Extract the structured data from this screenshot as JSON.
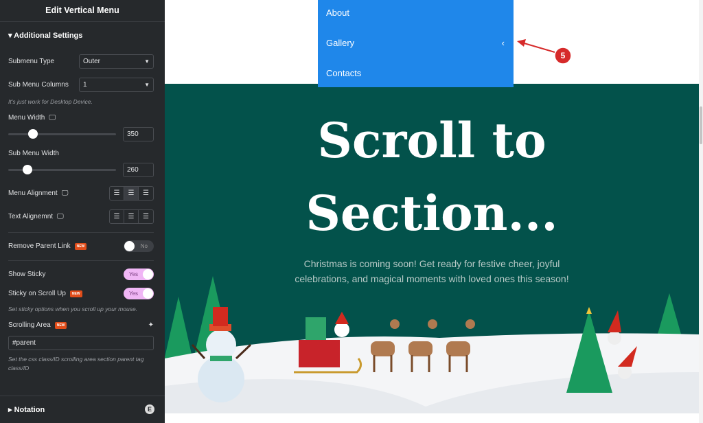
{
  "panel": {
    "title": "Edit Vertical Menu",
    "section": "Additional Settings",
    "submenu_type": {
      "label": "Submenu Type",
      "value": "Outer"
    },
    "sub_menu_columns": {
      "label": "Sub Menu Columns",
      "value": "1"
    },
    "desktop_note": "It's just work for Desktop Device.",
    "menu_width": {
      "label": "Menu Width",
      "value": "350",
      "slider_fraction": 0.23
    },
    "sub_menu_width": {
      "label": "Sub Menu Width",
      "value": "260",
      "slider_fraction": 0.18
    },
    "menu_alignment": {
      "label": "Menu Alignment",
      "selected": "center"
    },
    "text_alignment": {
      "label": "Text Alignemnt"
    },
    "remove_parent_link": {
      "label": "Remove Parent Link",
      "badge": "NEW",
      "value": "No"
    },
    "show_sticky": {
      "label": "Show Sticky",
      "value": "Yes"
    },
    "sticky_scroll_up": {
      "label": "Sticky on Scroll Up",
      "badge": "NEW",
      "value": "Yes"
    },
    "sticky_note": "Set sticky options when you scroll up your mouse.",
    "scrolling_area": {
      "label": "Scrolling Area",
      "badge": "NEW",
      "value": "#parent"
    },
    "scrolling_note": "Set the css class/ID scrolling area section parent tag class/ID",
    "notation": "Notation",
    "toggle_on_color": "#f0b6f5"
  },
  "preview": {
    "menu_items": [
      "About",
      "Gallery",
      "Contacts"
    ],
    "menu_color": "#1f87ea",
    "annotation": "5",
    "heading_line1": "Scroll to",
    "heading_line2": "Section...",
    "subtext_line1": "Christmas is coming soon! Get ready for festive cheer, joyful",
    "subtext_line2": "celebrations, and magical moments with loved ones this season!",
    "section_color": "#03524b"
  }
}
